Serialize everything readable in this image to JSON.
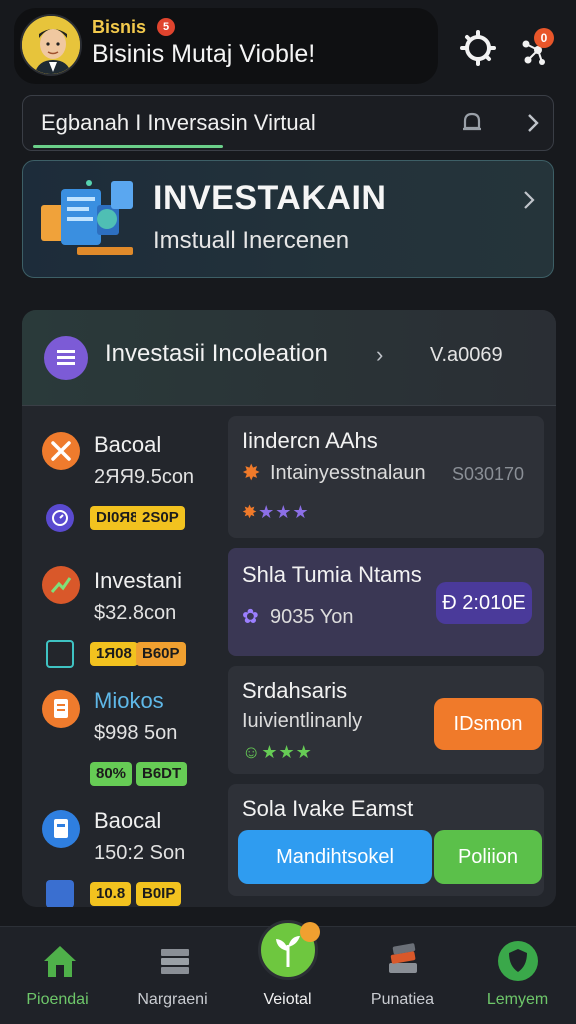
{
  "header": {
    "small_label": "Bisnis",
    "badge_count": "5",
    "title": "Bisinis Mutaj Vioble!",
    "notification_count": "0",
    "icons": [
      "settings-icon",
      "network-icon"
    ]
  },
  "search": {
    "text": "Egbanah I Inversasin Virtual"
  },
  "hero": {
    "title": "INVESTAKAIN",
    "subtitle": "Imstuall Inercenen"
  },
  "panel": {
    "title": "Investasii Incoleation",
    "value": "V.a0069",
    "left_items": [
      {
        "title": "Bacoal",
        "value": "2ЯЯ9.5con",
        "tag1": "DI0Я8",
        "tag2": "2S0P"
      },
      {
        "title": "Investani",
        "value": "$32.8con",
        "tag1": "1Я08",
        "tag2": "B60P"
      },
      {
        "title": "Miokos",
        "value": "$998 5on",
        "tag1": "80%",
        "tag2": "B6DT"
      },
      {
        "title": "Baocal",
        "value": "150:2 Son",
        "tag1": "10.8",
        "tag2": "B0IP"
      }
    ],
    "cards": [
      {
        "title": "Iindercn AAhs",
        "sub": "Intainyesstnalaun",
        "value": "S030170"
      },
      {
        "title": "Shla Tumia Ntams",
        "sub": "9035 Yon",
        "button": "Ð 2:010E"
      },
      {
        "title": "Srdahsaris",
        "sub": "Iuivientlinanly",
        "button": "IDsmon"
      },
      {
        "title": "Sola Ivake Eamst",
        "button_blue": "Mandihtsokel",
        "button_green": "Poliion"
      }
    ]
  },
  "bottom_nav": [
    {
      "label": "Pioendai",
      "icon": "home-icon"
    },
    {
      "label": "Nargraeni",
      "icon": "stack-icon"
    },
    {
      "label": "Veiotal",
      "icon": "plant-icon"
    },
    {
      "label": "Punatiea",
      "icon": "books-icon"
    },
    {
      "label": "Lemyem",
      "icon": "shield-icon"
    }
  ],
  "colors": {
    "accent_green": "#6ec73f",
    "accent_orange": "#f07a2a",
    "accent_blue": "#2f9cf0",
    "accent_purple": "#7c5bd6",
    "tag_yellow": "#f2c21f",
    "tag_green": "#66cc55"
  }
}
